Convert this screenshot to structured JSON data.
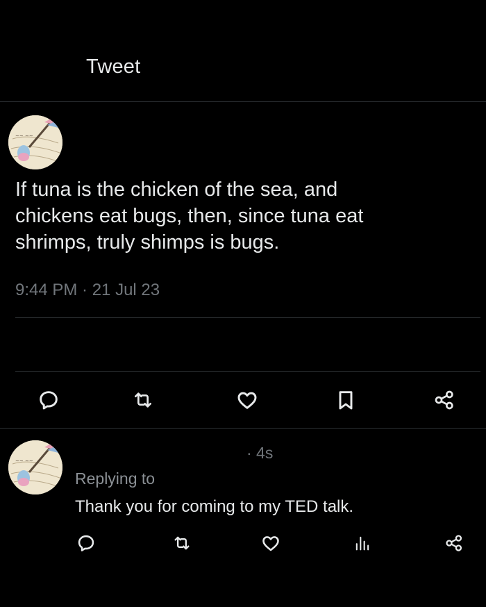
{
  "header": {
    "title": "Tweet"
  },
  "tweet": {
    "text_lines": [
      "If tuna is the chicken of the sea, and",
      "chickens eat bugs, then, since tuna eat",
      "shrimps, truly shimps is bugs."
    ],
    "timestamp": "9:44 PM · 21 Jul 23",
    "actions": [
      "reply-icon",
      "retweet-icon",
      "like-icon",
      "bookmark-icon",
      "share-icon"
    ]
  },
  "reply": {
    "time": "· 4s",
    "replying_to": "Replying to",
    "text": "Thank you for coming to my TED talk.",
    "actions": [
      "reply-icon",
      "retweet-icon",
      "like-icon",
      "views-icon",
      "share-icon"
    ]
  },
  "colors": {
    "background": "#000000",
    "text": "#e7e9ea",
    "secondary_text": "#71767b",
    "divider": "#2f3336"
  }
}
